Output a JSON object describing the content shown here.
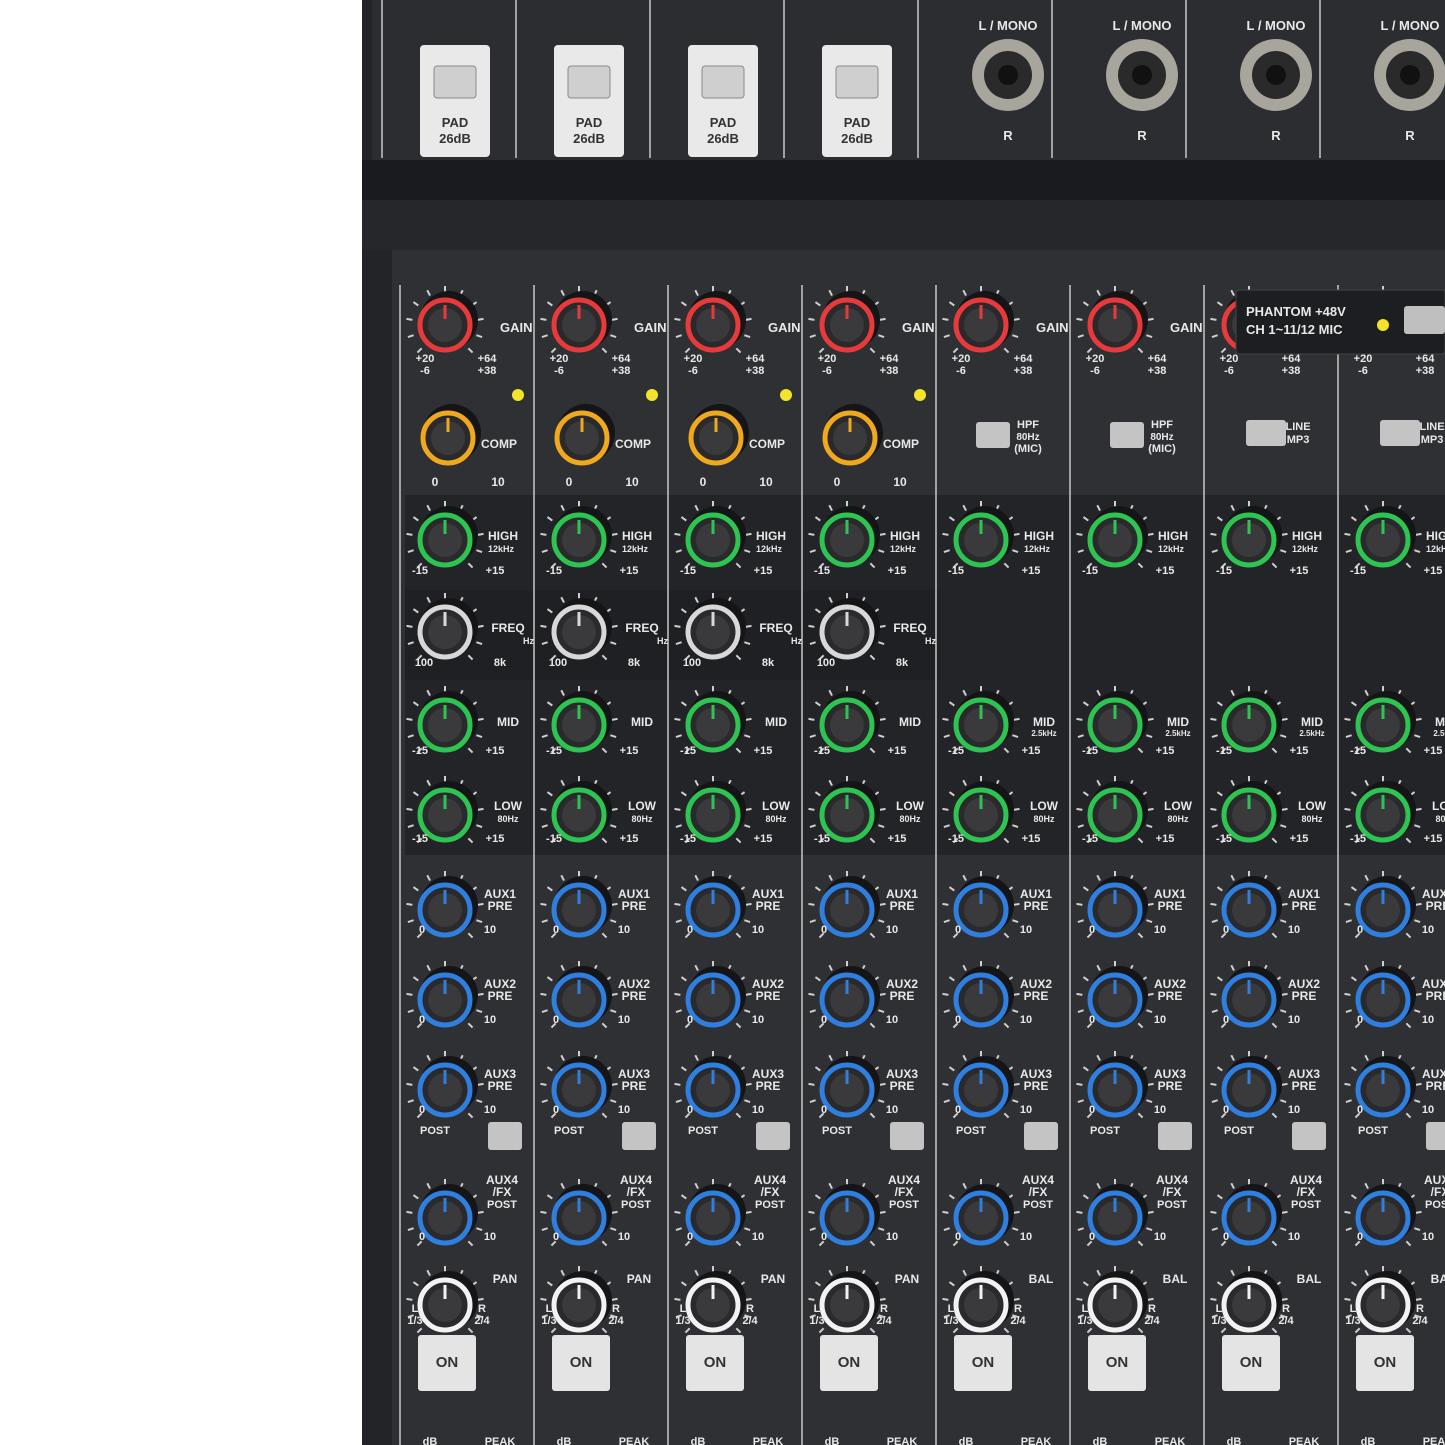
{
  "top": {
    "pad_label": "PAD",
    "pad_value": "26dB",
    "jack_top": "L / MONO",
    "jack_bottom": "R"
  },
  "phantom": {
    "line1": "PHANTOM +48V",
    "line2": "CH 1~11/12 MIC"
  },
  "labels": {
    "gain": "GAIN",
    "gain_min": "+20",
    "gain_min2": "-6",
    "gain_max": "+64",
    "gain_max2": "+38",
    "comp": "COMP",
    "comp_min": "0",
    "comp_max": "10",
    "hpf": "HPF",
    "hpf_freq": "80Hz",
    "hpf_mic": "(MIC)",
    "line": "LINE",
    "mp3": "MP3",
    "high": "HIGH",
    "high_freq": "12kHz",
    "eq_min": "-15",
    "eq_max": "+15",
    "freq": "FREQ",
    "freq_unit": "Hz",
    "freq_min": "100",
    "freq_max": "8k",
    "mid": "MID",
    "mid_freq": "2.5kHz",
    "low": "LOW",
    "low_freq": "80Hz",
    "aux1": "AUX1",
    "aux2": "AUX2",
    "aux3": "AUX3",
    "aux4": "AUX4",
    "pre": "PRE",
    "fx": "/FX",
    "post": "POST",
    "aux_min": "0",
    "aux_max": "10",
    "pan": "PAN",
    "bal": "BAL",
    "lr_left": "L",
    "lr_left2": "1/3",
    "lr_right": "R",
    "lr_right2": "2/4",
    "on": "ON",
    "db": "dB",
    "peak": "PEAK"
  },
  "colors": {
    "panel": "#2a2c30",
    "panel_dark": "#1b1c1f",
    "text": "#e8e8e8",
    "gain_ring": "#e83a3a",
    "comp_ring": "#f0a81c",
    "eq_ring": "#2ec452",
    "freq_ring": "#d8d8d8",
    "aux_ring": "#2e7fe0",
    "pan_ring": "#f2f2f2",
    "led": "#f3e32a"
  },
  "strips": [
    {
      "type": "mono",
      "pad": true
    },
    {
      "type": "mono",
      "pad": true
    },
    {
      "type": "mono",
      "pad": true
    },
    {
      "type": "mono",
      "pad": true
    },
    {
      "type": "stereo_hpf",
      "jack": true
    },
    {
      "type": "stereo_hpf",
      "jack": true
    },
    {
      "type": "stereo_line",
      "jack": true
    },
    {
      "type": "stereo_line",
      "jack": true
    }
  ]
}
